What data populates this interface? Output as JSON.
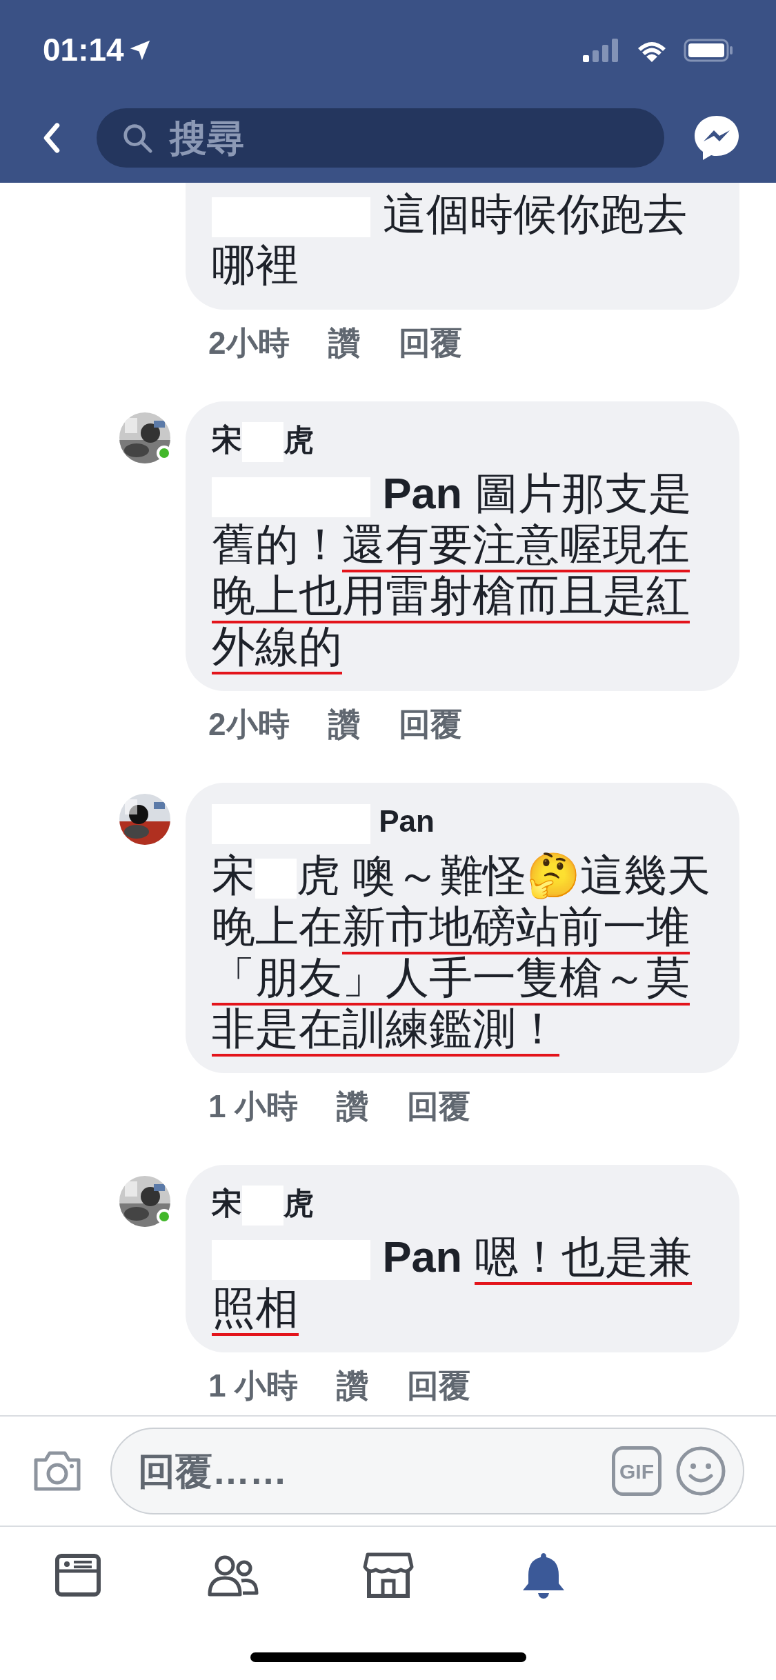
{
  "status_bar": {
    "time": "01:14"
  },
  "header": {
    "search": {
      "placeholder": "搜尋"
    }
  },
  "comments": [
    {
      "cut_top": true,
      "body": [
        {
          "kind": "redacted"
        },
        {
          "kind": "text",
          "text": " 這個時候你跑去哪裡"
        }
      ],
      "time": "2小時",
      "like": "讚",
      "reply": "回覆"
    },
    {
      "online": true,
      "name": [
        {
          "kind": "text",
          "text": "宋"
        },
        {
          "kind": "redacted"
        },
        {
          "kind": "text",
          "text": "虎"
        }
      ],
      "body": [
        {
          "kind": "redacted"
        },
        {
          "kind": "text",
          "text": " Pan",
          "bold": true
        },
        {
          "kind": "text",
          "text": " 圖片那支是舊的！"
        },
        {
          "kind": "text",
          "text": "還有要注意喔現在晚上也用雷射槍而且是紅外線的",
          "underline": true
        }
      ],
      "time": "2小時",
      "like": "讚",
      "reply": "回覆"
    },
    {
      "name": [
        {
          "kind": "redacted"
        },
        {
          "kind": "text",
          "text": " Pan"
        }
      ],
      "body": [
        {
          "kind": "text",
          "text": "宋"
        },
        {
          "kind": "redacted"
        },
        {
          "kind": "text",
          "text": "虎 噢～難怪🤔這幾天晚上在"
        },
        {
          "kind": "text",
          "text": "新市地磅站前一堆「朋友」人手一隻槍～莫非是在訓練鑑測！",
          "underline": true
        }
      ],
      "time": "1 小時",
      "like": "讚",
      "reply": "回覆"
    },
    {
      "online": true,
      "name": [
        {
          "kind": "text",
          "text": "宋"
        },
        {
          "kind": "redacted"
        },
        {
          "kind": "text",
          "text": "虎"
        }
      ],
      "body": [
        {
          "kind": "redacted"
        },
        {
          "kind": "text",
          "text": " Pan ",
          "bold": true
        },
        {
          "kind": "text",
          "text": "嗯！也是兼照相",
          "underline": true
        }
      ],
      "time": "1 小時",
      "like": "讚",
      "reply": "回覆"
    }
  ],
  "composer": {
    "placeholder": "回覆……",
    "gif": "GIF"
  },
  "tabs": [
    {
      "kind": "feed",
      "selected": false
    },
    {
      "kind": "friends",
      "selected": false
    },
    {
      "kind": "market",
      "selected": false
    },
    {
      "kind": "bell",
      "selected": true
    }
  ]
}
